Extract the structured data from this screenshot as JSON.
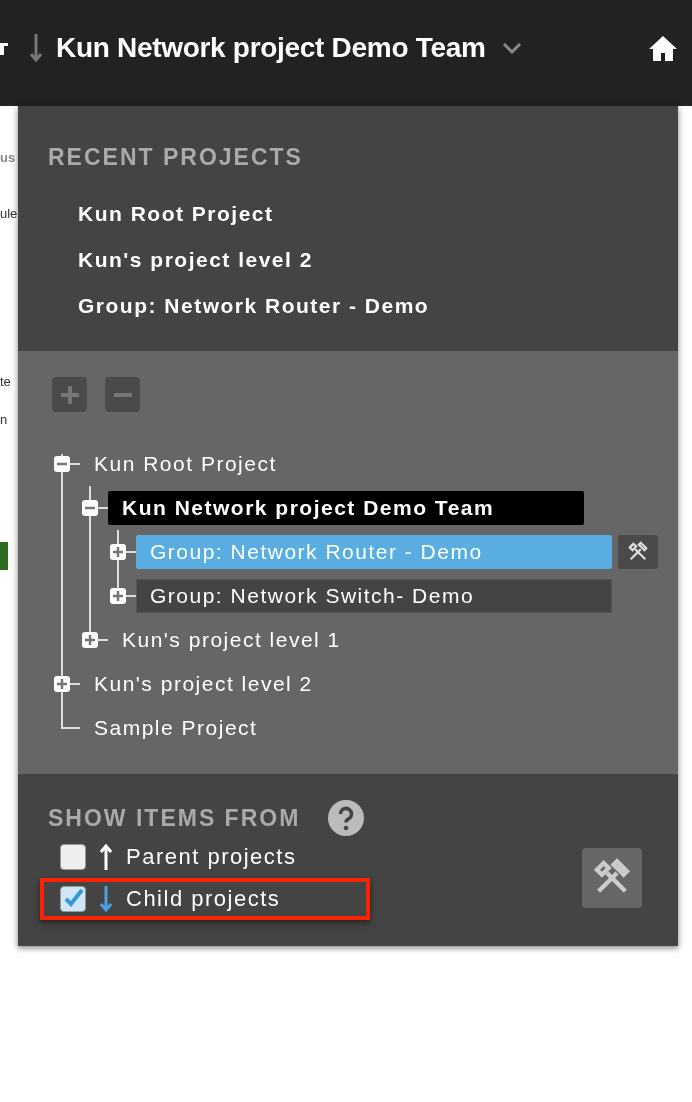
{
  "background_fragments": [
    "us",
    "ule",
    "te",
    "n"
  ],
  "header": {
    "title": "Kun Network project Demo Team"
  },
  "recent_projects": {
    "heading": "RECENT PROJECTS",
    "items": [
      "Kun Root Project",
      "Kun's project level 2",
      "Group: Network Router - Demo"
    ]
  },
  "tree": [
    {
      "label": "Kun Root Project",
      "current": false,
      "hovered": false,
      "selected": false,
      "expanded": true,
      "children": [
        {
          "label": "Kun Network project Demo Team",
          "current": true,
          "hovered": false,
          "selected": false,
          "expanded": true,
          "children": [
            {
              "label": "Group: Network Router - Demo",
              "current": false,
              "hovered": false,
              "selected": true,
              "expanded": false
            },
            {
              "label": "Group: Network Switch- Demo",
              "current": false,
              "hovered": true,
              "selected": false,
              "expanded": false
            }
          ]
        },
        {
          "label": "Kun's project level 1",
          "current": false,
          "hovered": false,
          "selected": false,
          "expanded": false
        }
      ]
    },
    {
      "label": "Kun's project level 2",
      "current": false,
      "hovered": false,
      "selected": false,
      "expanded": false
    },
    {
      "label": "Sample Project",
      "current": false,
      "hovered": false,
      "selected": false
    }
  ],
  "show_items_from": {
    "heading": "SHOW ITEMS FROM",
    "options": [
      {
        "label": "Parent projects",
        "kind": "up",
        "checked": false,
        "highlighted": false
      },
      {
        "label": "Child projects",
        "kind": "down",
        "checked": true,
        "highlighted": true
      }
    ]
  }
}
